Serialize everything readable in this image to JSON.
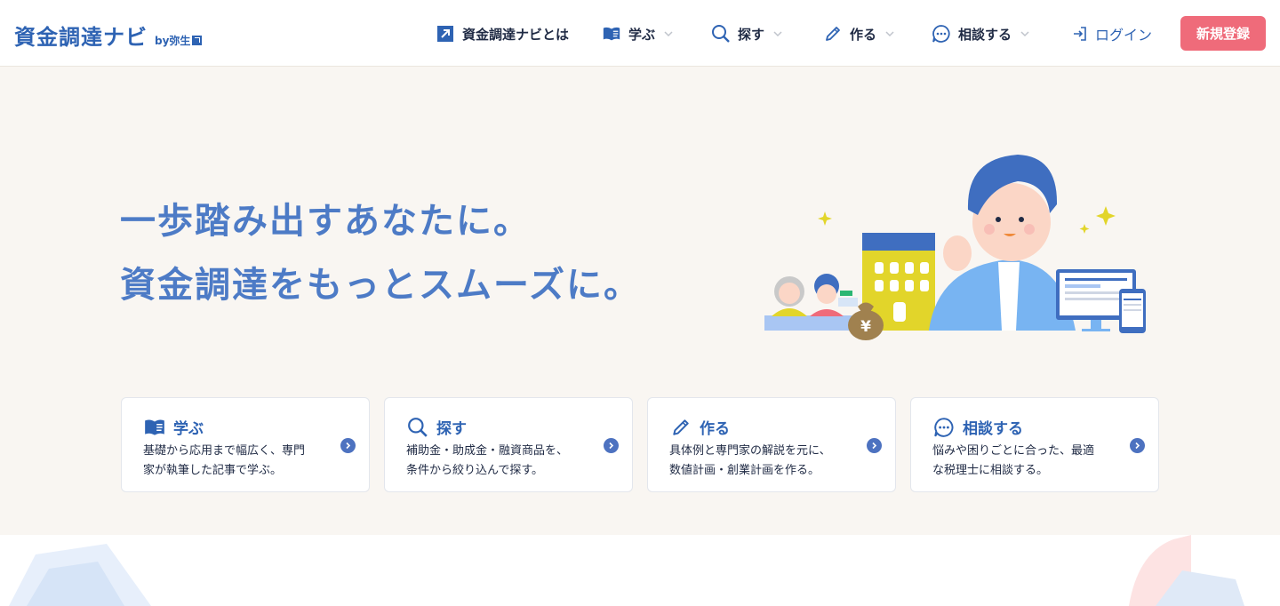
{
  "header": {
    "logo_main": "資金調達ナビ",
    "logo_sub": "by弥生",
    "nav": {
      "about": "資金調達ナビとは",
      "learn": "学ぶ",
      "search": "探す",
      "create": "作る",
      "consult": "相談する",
      "login": "ログイン"
    },
    "signup_label": "新規登録"
  },
  "hero": {
    "title_line1": "一歩踏み出すあなたに。",
    "title_line2": "資金調達をもっとスムーズに。",
    "illustration_money_bag": "¥"
  },
  "cards": [
    {
      "icon": "book-icon",
      "title": "学ぶ",
      "desc_line1": "基礎から応用まで幅広く、専門",
      "desc_line2": "家が執筆した記事で学ぶ。"
    },
    {
      "icon": "search-icon",
      "title": "探す",
      "desc_line1": "補助金・助成金・融資商品を、",
      "desc_line2": "条件から絞り込んで探す。"
    },
    {
      "icon": "pencil-icon",
      "title": "作る",
      "desc_line1": "具体例と専門家の解説を元に、",
      "desc_line2": "数値計画・創業計画を作る。"
    },
    {
      "icon": "chat-bubble-icon",
      "title": "相談する",
      "desc_line1": "悩みや困りごとに合った、最適",
      "desc_line2": "な税理士に相談する。"
    }
  ],
  "colors": {
    "brand_blue": "#2e63b3",
    "hero_text": "#4d7bc6",
    "signup_pink": "#ef6b7a",
    "hero_bg": "#f9f6f2"
  }
}
